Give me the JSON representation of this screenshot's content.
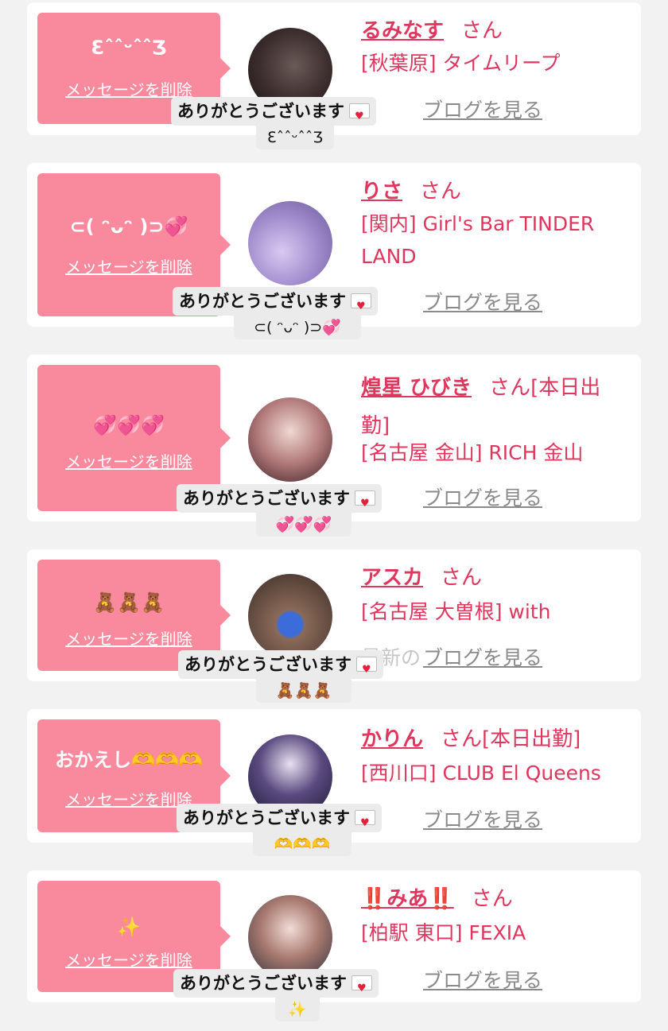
{
  "colors": {
    "accent": "#e0365e",
    "bubble": "#f98a9e",
    "card": "#ffffff",
    "page": "#f2f2f2",
    "muted": "#8a8a8a"
  },
  "common": {
    "delete_label": "メッセージを削除",
    "blog_label": "ブログを見る",
    "toast_text": "ありがとうございます",
    "latest_label": "最新の",
    "envelope_icon": "love-letter-icon"
  },
  "cards": [
    {
      "message": "ƐˆˆᵕˆˆƷ",
      "name": "るみなす",
      "suffix": "さん",
      "shop": "[秋葉原] タイムリープ",
      "toast_sub": "ƐˆˆᵕˆˆƷ"
    },
    {
      "message": "⊂( ᵔᴗᵔ )⊃💞",
      "name": "りさ",
      "suffix": "さん",
      "shop": "[関内] Girl's Bar TINDER LAND",
      "toast_sub": "⊂( ᵔᴗᵔ )⊃💞"
    },
    {
      "message": "💞💞💞",
      "name": "煌星 ひびき",
      "suffix": "さん[本日出勤]",
      "shop": "[名古屋 金山] RICH 金山",
      "toast_sub": "💞💞💞"
    },
    {
      "message": "🧸🧸🧸",
      "name": "アスカ",
      "suffix": "さん",
      "shop": "[名古屋 大曽根] with",
      "toast_sub": "🧸🧸🧸"
    },
    {
      "message": "おかえし🫶🫶🫶",
      "name": "かりん",
      "suffix": "さん[本日出勤]",
      "shop": "[西川口] CLUB El Queens",
      "toast_sub": "🫶🫶🫶"
    },
    {
      "message": "✨",
      "name": "‼️みあ‼️",
      "suffix": "さん",
      "shop": "[柏駅 東口] FEXIA",
      "toast_sub": "✨"
    }
  ]
}
